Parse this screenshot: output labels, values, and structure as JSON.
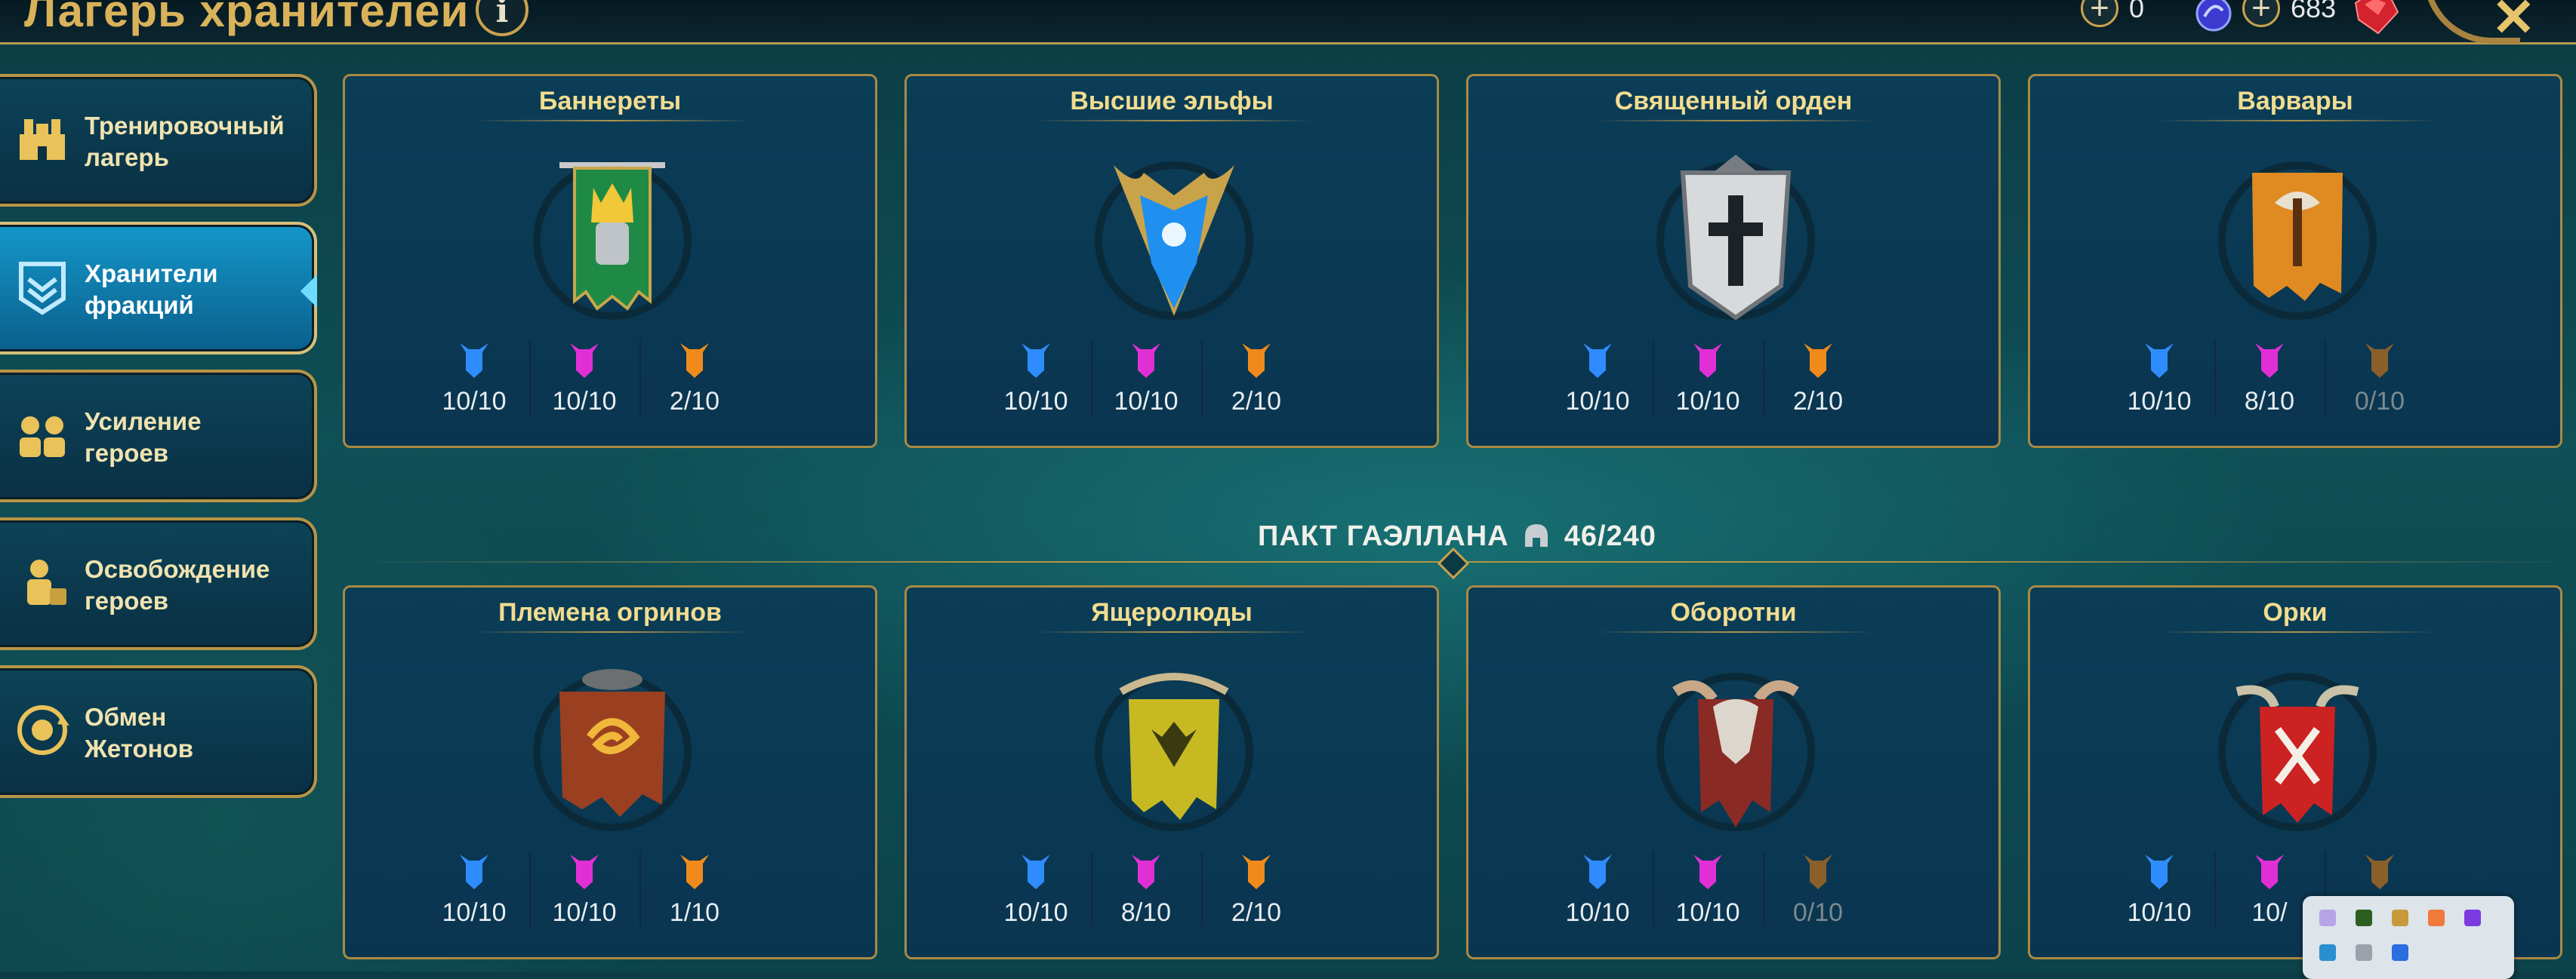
{
  "header": {
    "title": "Лагерь хранителей",
    "info_icon": "i",
    "resources": [
      {
        "value": "0",
        "icon": "sphere-icon"
      },
      {
        "value": "683",
        "icon": "ruby-icon"
      }
    ],
    "close_icon": "✕"
  },
  "sidebar": {
    "items": [
      {
        "label": "Тренировочный\nлагерь",
        "icon": "training-camp-icon",
        "active": false
      },
      {
        "label": "Хранители\nфракций",
        "icon": "faction-guardians-icon",
        "active": true
      },
      {
        "label": "Усиление\nгероев",
        "icon": "hero-boost-icon",
        "active": false
      },
      {
        "label": "Освобождение\nгероев",
        "icon": "hero-release-icon",
        "active": false
      },
      {
        "label": "Обмен\nЖетонов",
        "icon": "token-exchange-icon",
        "active": false
      }
    ]
  },
  "colors": {
    "rare": "#2f8cff",
    "epic": "#e12fd6",
    "legendary": "#f08a1a",
    "gold": "#d9b25a"
  },
  "factions_top": [
    {
      "name": "Баннереты",
      "stats": [
        "10/10",
        "10/10",
        "2/10"
      ],
      "dim": [
        false,
        false,
        false
      ]
    },
    {
      "name": "Высшие эльфы",
      "stats": [
        "10/10",
        "10/10",
        "2/10"
      ],
      "dim": [
        false,
        false,
        false
      ]
    },
    {
      "name": "Священный орден",
      "stats": [
        "10/10",
        "10/10",
        "2/10"
      ],
      "dim": [
        false,
        false,
        false
      ]
    },
    {
      "name": "Варвары",
      "stats": [
        "10/10",
        "8/10",
        "0/10"
      ],
      "dim": [
        false,
        false,
        true
      ]
    }
  ],
  "pact": {
    "label": "ПАКТ ГАЭЛЛАНА",
    "value": "46/240"
  },
  "factions_bottom": [
    {
      "name": "Племена огринов",
      "stats": [
        "10/10",
        "10/10",
        "1/10"
      ],
      "dim": [
        false,
        false,
        false
      ]
    },
    {
      "name": "Ящеролюды",
      "stats": [
        "10/10",
        "8/10",
        "2/10"
      ],
      "dim": [
        false,
        false,
        false
      ]
    },
    {
      "name": "Оборотни",
      "stats": [
        "10/10",
        "10/10",
        "0/10"
      ],
      "dim": [
        false,
        false,
        true
      ]
    },
    {
      "name": "Орки",
      "stats": [
        "10/10",
        "10/",
        ""
      ],
      "dim": [
        false,
        false,
        false
      ]
    }
  ]
}
